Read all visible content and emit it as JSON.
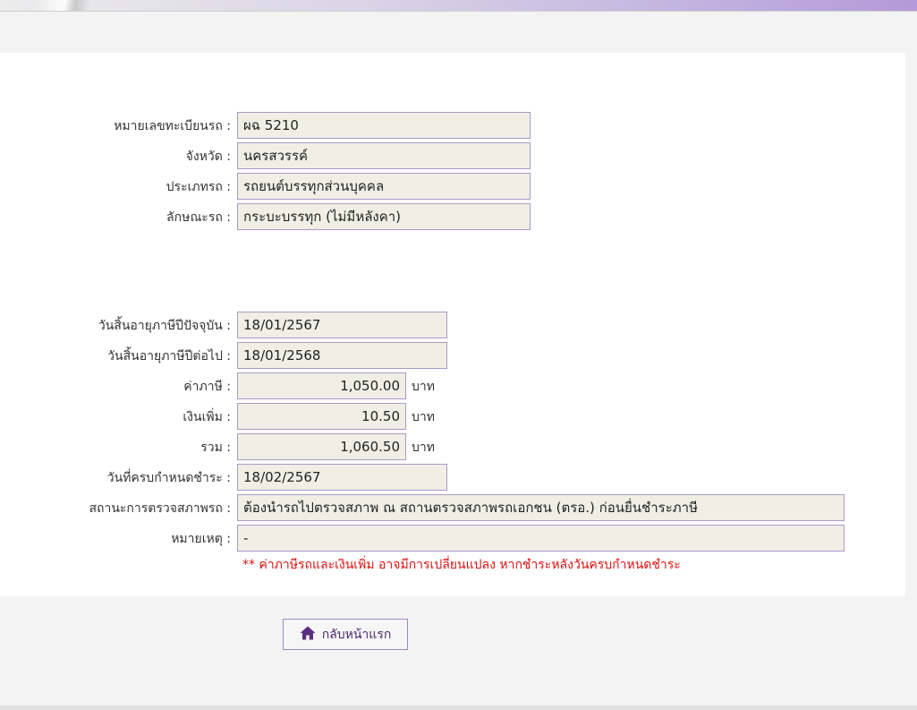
{
  "vehicle": {
    "plate_label": "หมายเลขทะเบียนรถ :",
    "plate_value": "ผฉ 5210",
    "province_label": "จังหวัด :",
    "province_value": "นครสวรรค์",
    "type_label": "ประเภทรถ :",
    "type_value": "รถยนต์บรรทุกส่วนบุคคล",
    "style_label": "ลักษณะรถ :",
    "style_value": "กระบะบรรทุก (ไม่มีหลังคา)"
  },
  "tax": {
    "current_expiry_label": "วันสิ้นอายุภาษีปีปัจจุบัน :",
    "current_expiry_value": "18/01/2567",
    "next_expiry_label": "วันสิ้นอายุภาษีปีต่อไป :",
    "next_expiry_value": "18/01/2568",
    "fee_label": "ค่าภาษี :",
    "fee_value": "1,050.00",
    "fee_unit": "บาท",
    "surcharge_label": "เงินเพิ่ม :",
    "surcharge_value": "10.50",
    "surcharge_unit": "บาท",
    "total_label": "รวม :",
    "total_value": "1,060.50",
    "total_unit": "บาท",
    "due_label": "วันที่ครบกำหนดชำระ :",
    "due_value": "18/02/2567",
    "inspection_label": "สถานะการตรวจสภาพรถ :",
    "inspection_value": "ต้องนำรถไปตรวจสภาพ ณ สถานตรวจสภาพรถเอกชน (ตรอ.) ก่อนยื่นชำระภาษี",
    "remark_label": "หมายเหตุ :",
    "remark_value": "-",
    "warning": "** ค่าภาษีรถและเงินเพิ่ม อาจมีการเปลี่ยนแปลง หากชำระหลังวันครบกำหนดชำระ"
  },
  "actions": {
    "home_label": "กลับหน้าแรก",
    "home_icon": "home-icon"
  },
  "colors": {
    "field_bg": "#efefe5",
    "field_border": "#a99ac7",
    "warning": "#dd1111",
    "button_text": "#4a2a6e"
  }
}
